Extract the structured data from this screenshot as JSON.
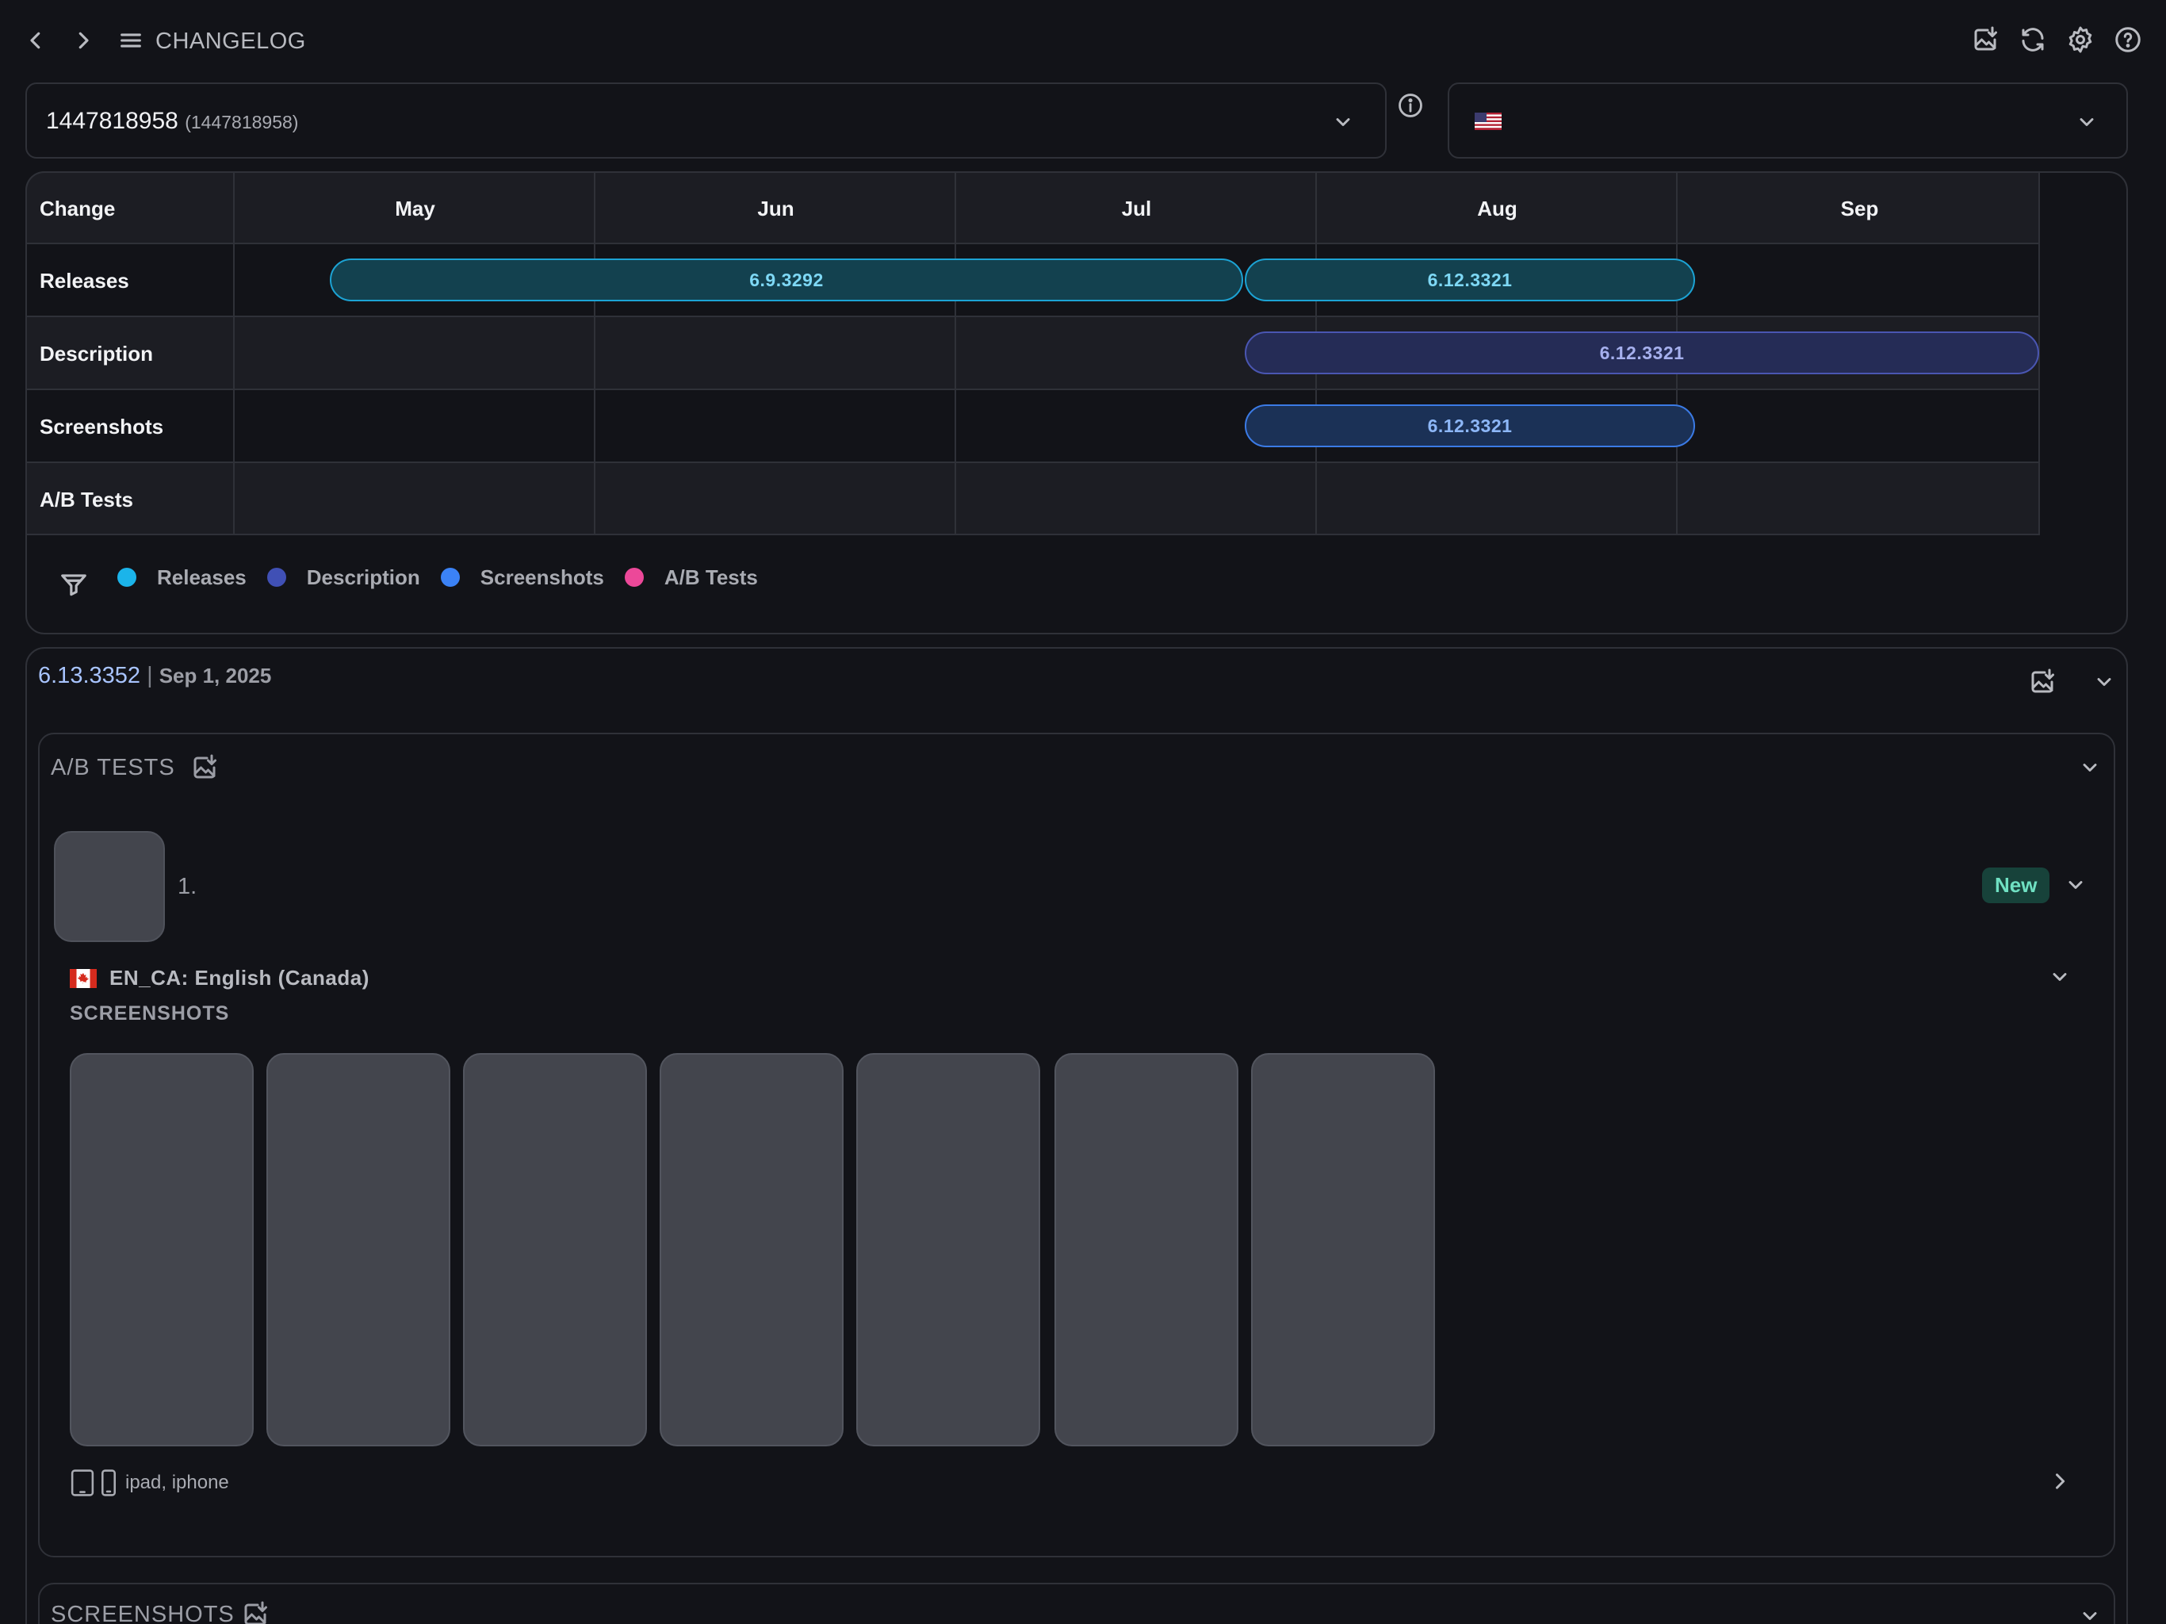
{
  "toolbar": {
    "title": "CHANGELOG",
    "back_icon": "chevron-left-icon",
    "forward_icon": "chevron-right-icon",
    "menu_icon": "hamburger-menu-icon",
    "right_icons": [
      "image-download-icon",
      "refresh-icon",
      "settings-gear-icon",
      "help-circle-icon"
    ]
  },
  "app_select": {
    "value": "1447818958",
    "sub_value": "(1447818958)"
  },
  "country_select": {
    "flag": "us-flag-icon"
  },
  "timeline": {
    "header_label": "Change",
    "months": [
      "May",
      "Jun",
      "Jul",
      "Aug",
      "Sep"
    ],
    "rows": [
      {
        "label": "Releases",
        "bars": [
          "6.9.3292",
          "6.12.3321"
        ]
      },
      {
        "label": "Description",
        "bars": [
          "6.12.3321"
        ]
      },
      {
        "label": "Screenshots",
        "bars": [
          "6.12.3321"
        ]
      },
      {
        "label": "A/B Tests",
        "bars": []
      }
    ],
    "legend": [
      {
        "label": "Releases",
        "color": "#1bb4ea"
      },
      {
        "label": "Description",
        "color": "#4050b5"
      },
      {
        "label": "Screenshots",
        "color": "#3b82f6"
      },
      {
        "label": "A/B Tests",
        "color": "#ec4899"
      }
    ]
  },
  "release": {
    "version": "6.13.3352",
    "separator": "|",
    "date": "Sep 1, 2025"
  },
  "ab_tests": {
    "title": "A/B TESTS",
    "item_number": "1.",
    "badge": "New",
    "locale": "EN_CA: English (Canada)",
    "screenshots_label": "SCREENSHOTS",
    "screenshot_count": 7,
    "devices": "ipad, iphone"
  },
  "screenshots_section": {
    "title": "SCREENSHOTS"
  },
  "colors": {
    "background": "#121318",
    "border": "#2f3138",
    "release_bar": "#13414f",
    "description_bar": "#252c56",
    "screenshot_bar": "#1b3156",
    "badge_bg": "#17423a"
  }
}
